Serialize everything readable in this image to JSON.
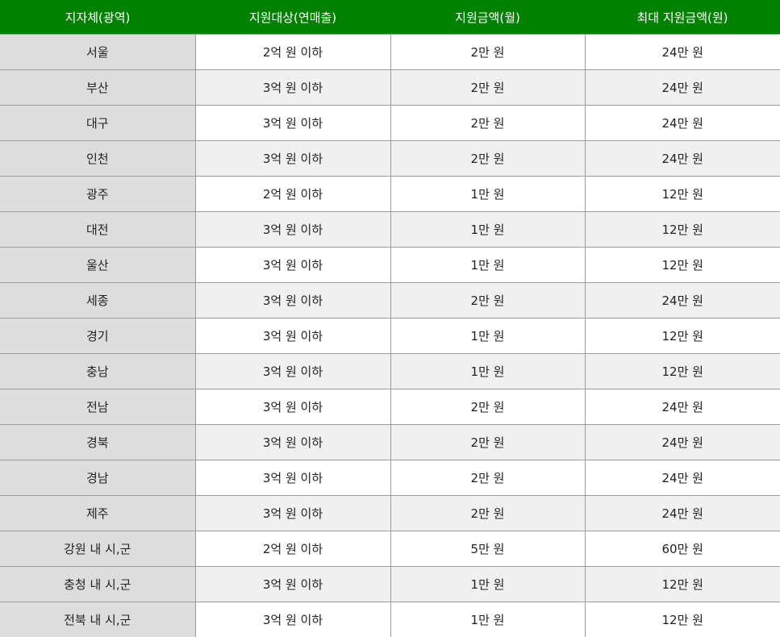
{
  "table": {
    "headers": [
      "지자체(광역)",
      "지원대상(연매출)",
      "지원금액(월)",
      "최대 지원금액(원)"
    ],
    "rows": [
      [
        "서울",
        "2억 원 이하",
        "2만 원",
        "24만 원"
      ],
      [
        "부산",
        "3억 원 이하",
        "2만 원",
        "24만 원"
      ],
      [
        "대구",
        "3억 원 이하",
        "2만 원",
        "24만 원"
      ],
      [
        "인천",
        "3억 원 이하",
        "2만 원",
        "24만 원"
      ],
      [
        "광주",
        "2억 원 이하",
        "1만 원",
        "12만 원"
      ],
      [
        "대전",
        "3억 원 이하",
        "1만 원",
        "12만 원"
      ],
      [
        "울산",
        "3억 원 이하",
        "1만 원",
        "12만 원"
      ],
      [
        "세종",
        "3억 원 이하",
        "2만 원",
        "24만 원"
      ],
      [
        "경기",
        "3억 원 이하",
        "1만 원",
        "12만 원"
      ],
      [
        "충남",
        "3억 원 이하",
        "1만 원",
        "12만 원"
      ],
      [
        "전남",
        "3억 원 이하",
        "2만 원",
        "24만 원"
      ],
      [
        "경북",
        "3억 원 이하",
        "2만 원",
        "24만 원"
      ],
      [
        "경남",
        "3억 원 이하",
        "2만 원",
        "24만 원"
      ],
      [
        "제주",
        "3억 원 이하",
        "2만 원",
        "24만 원"
      ],
      [
        "강원 내 시,군",
        "2억 원 이하",
        "5만 원",
        "60만 원"
      ],
      [
        "충청 내 시,군",
        "3억 원 이하",
        "1만 원",
        "12만 원"
      ],
      [
        "전북 내 시,군",
        "3억 원 이하",
        "1만 원",
        "12만 원"
      ]
    ]
  },
  "colors": {
    "header_bg": "#008200",
    "header_text": "#ffffff",
    "first_col_bg": "#dcdddc",
    "stripe_bg": "#f0f0f0",
    "border": "#9c9c9c"
  }
}
